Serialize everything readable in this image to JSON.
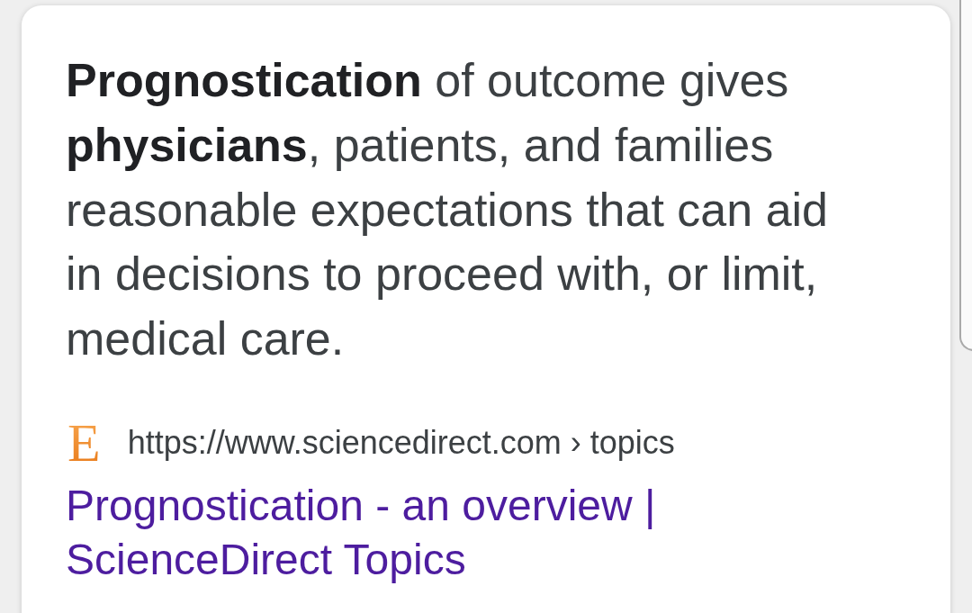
{
  "result": {
    "snippet_lines": [
      "**Prognostication** of outcome gives",
      "**physicians**, patients, and families",
      "reasonable expectations that can aid",
      "in decisions to proceed with, or limit,",
      "medical care."
    ],
    "source": {
      "favicon": "E",
      "url": "https://www.sciencedirect.com › topics"
    },
    "title": "Prognostication - an overview | ScienceDirect Topics"
  }
}
